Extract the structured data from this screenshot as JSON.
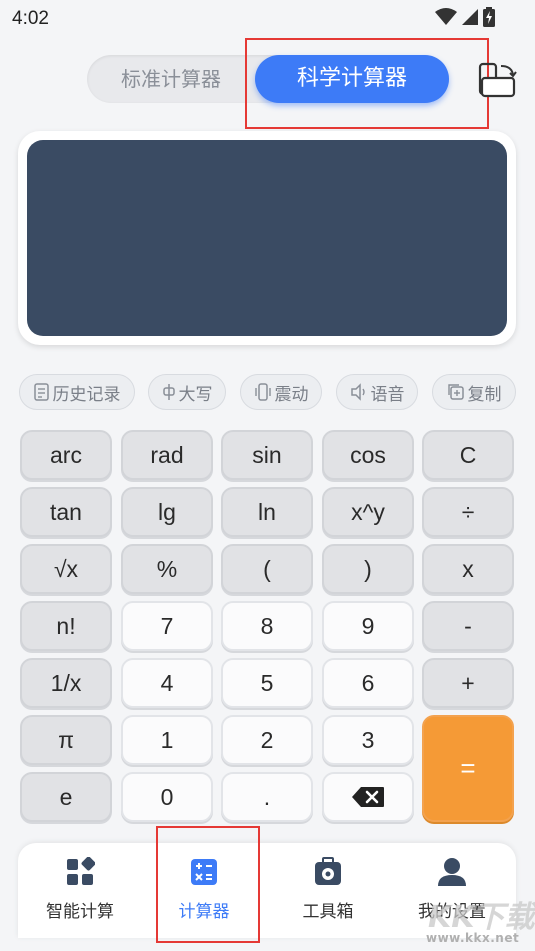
{
  "status_bar": {
    "time": "4:02",
    "icons": [
      "wifi-icon",
      "cell-signal-icon",
      "battery-charging-icon"
    ]
  },
  "mode_toggle": {
    "standard_label": "标准计算器",
    "scientific_label": "科学计算器",
    "selected": "scientific",
    "accent_color": "#3d7bf7"
  },
  "display": {
    "expression": "",
    "result": "",
    "background_color": "#3a4b63"
  },
  "chips": [
    {
      "label": "历史记录",
      "icon": "history-icon"
    },
    {
      "label": "大写",
      "icon": "uppercase-icon"
    },
    {
      "label": "震动",
      "icon": "vibrate-icon"
    },
    {
      "label": "语音",
      "icon": "speaker-icon"
    },
    {
      "label": "复制",
      "icon": "copy-icon"
    }
  ],
  "keypad": {
    "rows": [
      [
        "arc",
        "rad",
        "sin",
        "cos",
        "C"
      ],
      [
        "tan",
        "lg",
        "ln",
        "x^y",
        "÷"
      ],
      [
        "√x",
        "%",
        "(",
        ")",
        "x"
      ],
      [
        "n!",
        "7",
        "8",
        "9",
        "-"
      ],
      [
        "1/x",
        "4",
        "5",
        "6",
        "+"
      ],
      [
        "π",
        "1",
        "2",
        "3",
        "="
      ],
      [
        "e",
        "0",
        ".",
        "⌫"
      ]
    ],
    "equal_color": "#f59a36"
  },
  "bottom_nav": {
    "items": [
      {
        "label": "智能计算",
        "icon": "grid-apps-icon"
      },
      {
        "label": "计算器",
        "icon": "calculator-icon"
      },
      {
        "label": "工具箱",
        "icon": "toolbox-icon"
      },
      {
        "label": "我的设置",
        "icon": "user-icon"
      }
    ],
    "active_index": 1
  },
  "watermark": {
    "big": "KK下载",
    "small": "www.kkx.net"
  }
}
